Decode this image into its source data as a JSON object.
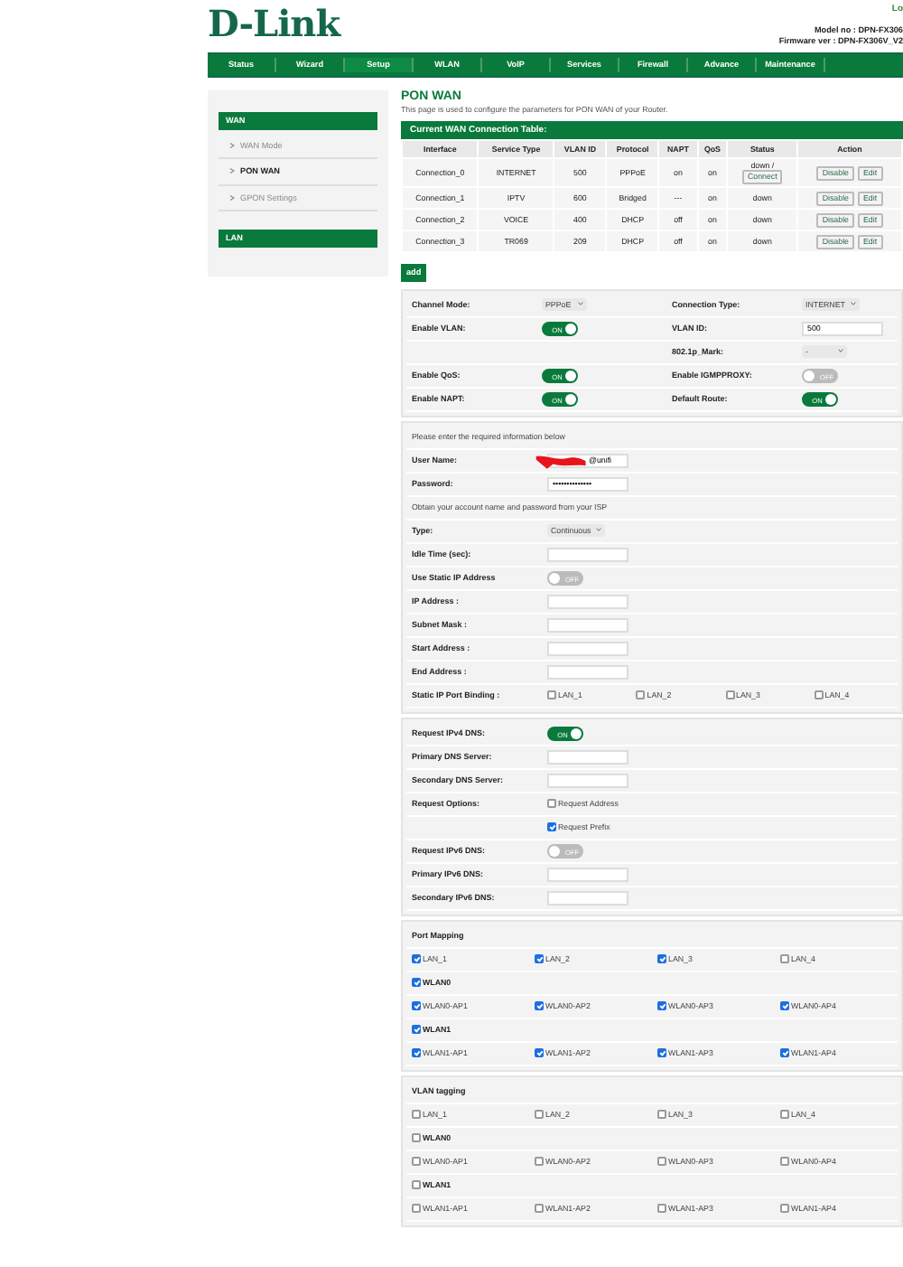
{
  "header": {
    "logo": "D-Link",
    "logout": "Lo",
    "model": "Model no : DPN-FX306",
    "firmware": "Firmware ver : DPN-FX306V_V2"
  },
  "nav": [
    {
      "label": "Status",
      "selected": false
    },
    {
      "label": "Wizard",
      "selected": false
    },
    {
      "label": "Setup",
      "selected": true
    },
    {
      "label": "WLAN",
      "selected": false
    },
    {
      "label": "VoIP",
      "selected": false
    },
    {
      "label": "Services",
      "selected": false
    },
    {
      "label": "Firewall",
      "selected": false
    },
    {
      "label": "Advance",
      "selected": false
    },
    {
      "label": "Maintenance",
      "selected": false
    }
  ],
  "sidebar": [
    {
      "title": "WAN",
      "items": [
        {
          "label": "WAN Mode",
          "selected": false
        },
        {
          "label": "PON WAN",
          "selected": true
        },
        {
          "label": "GPON Settings",
          "selected": false
        }
      ]
    },
    {
      "title": "LAN"
    }
  ],
  "page": {
    "title": "PON WAN",
    "description": "This page is used to configure the parameters for PON WAN of your Router."
  },
  "wan_table": {
    "title": "Current WAN Connection Table:",
    "columns": [
      "Interface",
      "Service Type",
      "VLAN ID",
      "Protocol",
      "NAPT",
      "QoS",
      "Status",
      "Action"
    ],
    "rows": [
      {
        "cells": [
          "Connection_0",
          "INTERNET",
          "500",
          "PPPoE",
          "on",
          "on",
          "down /"
        ],
        "status_button": "Connect",
        "actions": [
          "Disable",
          "Edit"
        ]
      },
      {
        "cells": [
          "Connection_1",
          "IPTV",
          "600",
          "Bridged",
          "---",
          "on",
          "down"
        ],
        "actions": [
          "Disable",
          "Edit"
        ]
      },
      {
        "cells": [
          "Connection_2",
          "VOICE",
          "400",
          "DHCP",
          "off",
          "on",
          "down"
        ],
        "actions": [
          "Disable",
          "Edit"
        ]
      },
      {
        "cells": [
          "Connection_3",
          "TR069",
          "209",
          "DHCP",
          "off",
          "on",
          "down"
        ],
        "actions": [
          "Disable",
          "Edit"
        ]
      }
    ]
  },
  "add_button": "add",
  "settings": [
    [
      {
        "kind": "label",
        "text": "Channel Mode:"
      },
      {
        "kind": "select",
        "value": "PPPoE"
      },
      {
        "kind": "label",
        "text": "Connection Type:"
      },
      {
        "kind": "select",
        "value": "INTERNET"
      }
    ],
    [
      {
        "kind": "label",
        "text": "Enable VLAN:"
      },
      {
        "kind": "toggle",
        "on": true,
        "text": "ON"
      },
      {
        "kind": "label",
        "text": "VLAN ID:"
      },
      {
        "kind": "input",
        "value": "500"
      }
    ],
    [
      {
        "kind": "empty"
      },
      {
        "kind": "empty"
      },
      {
        "kind": "label",
        "text": "802.1p_Mark:"
      },
      {
        "kind": "select",
        "value": "-"
      }
    ],
    [
      {
        "kind": "label",
        "text": "Enable QoS:"
      },
      {
        "kind": "toggle",
        "on": true,
        "text": "ON"
      },
      {
        "kind": "label",
        "text": "Enable IGMPPROXY:"
      },
      {
        "kind": "toggle",
        "on": false,
        "text": "OFF"
      }
    ],
    [
      {
        "kind": "label",
        "text": "Enable NAPT:"
      },
      {
        "kind": "toggle",
        "on": true,
        "text": "ON"
      },
      {
        "kind": "label",
        "text": "Default Route:"
      },
      {
        "kind": "toggle",
        "on": true,
        "text": "ON"
      }
    ]
  ],
  "ppp": [
    [
      {
        "kind": "note",
        "text": "Please enter the required information below"
      }
    ],
    [
      {
        "kind": "label",
        "text": "User Name:"
      },
      {
        "kind": "input",
        "value": "@unifi",
        "redacted": true
      }
    ],
    [
      {
        "kind": "label",
        "text": "Password:"
      },
      {
        "kind": "input",
        "value": "••••••••••••••"
      }
    ],
    [
      {
        "kind": "note",
        "text": "Obtain your account name and password from your ISP"
      }
    ],
    [
      {
        "kind": "label",
        "text": "Type:"
      },
      {
        "kind": "select",
        "value": "Continuous"
      }
    ],
    [
      {
        "kind": "label",
        "text": "Idle Time (sec):"
      },
      {
        "kind": "input"
      }
    ],
    [
      {
        "kind": "label",
        "text": "Use Static IP Address"
      },
      {
        "kind": "toggle",
        "on": false,
        "text": "OFF"
      }
    ],
    [
      {
        "kind": "label",
        "text": "IP Address :"
      },
      {
        "kind": "input"
      }
    ],
    [
      {
        "kind": "label",
        "text": "Subnet Mask :"
      },
      {
        "kind": "input"
      }
    ],
    [
      {
        "kind": "label",
        "text": "Start Address :"
      },
      {
        "kind": "input"
      }
    ],
    [
      {
        "kind": "label",
        "text": "End Address :"
      },
      {
        "kind": "input"
      }
    ],
    [
      {
        "kind": "label",
        "text": "Static IP Port Binding :"
      },
      {
        "kind": "checkbox",
        "label": "LAN_1",
        "checked": false
      },
      {
        "kind": "checkbox",
        "label": "LAN_2",
        "checked": false
      },
      {
        "kind": "checkbox",
        "label": "LAN_3",
        "checked": false
      },
      {
        "kind": "checkbox",
        "label": "LAN_4",
        "checked": false
      }
    ]
  ],
  "dns": [
    [
      {
        "kind": "label",
        "text": "Request IPv4 DNS:"
      },
      {
        "kind": "toggle",
        "on": true,
        "text": "ON"
      }
    ],
    [
      {
        "kind": "label",
        "text": "Primary DNS Server:"
      },
      {
        "kind": "input"
      }
    ],
    [
      {
        "kind": "label",
        "text": "Secondary DNS Server:"
      },
      {
        "kind": "input"
      }
    ],
    [
      {
        "kind": "label",
        "text": "Request Options:"
      },
      {
        "kind": "checkbox",
        "label": "Request Address",
        "checked": false
      }
    ],
    [
      {
        "kind": "empty"
      },
      {
        "kind": "checkbox",
        "label": "Request Prefix",
        "checked": true
      }
    ],
    [
      {
        "kind": "label",
        "text": "Request IPv6 DNS:"
      },
      {
        "kind": "toggle",
        "on": false,
        "text": "OFF"
      }
    ],
    [
      {
        "kind": "label",
        "text": "Primary IPv6 DNS:"
      },
      {
        "kind": "input"
      }
    ],
    [
      {
        "kind": "label",
        "text": "Secondary IPv6 DNS:"
      },
      {
        "kind": "input"
      }
    ]
  ],
  "port_mapping": [
    [
      {
        "kind": "heading",
        "text": "Port Mapping"
      }
    ],
    [
      {
        "kind": "checkbox",
        "label": "LAN_1",
        "checked": true
      },
      {
        "kind": "checkbox",
        "label": "LAN_2",
        "checked": true
      },
      {
        "kind": "checkbox",
        "label": "LAN_3",
        "checked": true
      },
      {
        "kind": "checkbox",
        "label": "LAN_4",
        "checked": false
      }
    ],
    [
      {
        "kind": "group",
        "label": "WLAN0",
        "checked": true
      }
    ],
    [
      {
        "kind": "checkbox",
        "label": "WLAN0-AP1",
        "checked": true
      },
      {
        "kind": "checkbox",
        "label": "WLAN0-AP2",
        "checked": true
      },
      {
        "kind": "checkbox",
        "label": "WLAN0-AP3",
        "checked": true
      },
      {
        "kind": "checkbox",
        "label": "WLAN0-AP4",
        "checked": true
      }
    ],
    [
      {
        "kind": "group",
        "label": "WLAN1",
        "checked": true
      }
    ],
    [
      {
        "kind": "checkbox",
        "label": "WLAN1-AP1",
        "checked": true
      },
      {
        "kind": "checkbox",
        "label": "WLAN1-AP2",
        "checked": true
      },
      {
        "kind": "checkbox",
        "label": "WLAN1-AP3",
        "checked": true
      },
      {
        "kind": "checkbox",
        "label": "WLAN1-AP4",
        "checked": true
      }
    ]
  ],
  "vlan_tagging": [
    [
      {
        "kind": "heading",
        "text": "VLAN tagging"
      }
    ],
    [
      {
        "kind": "checkbox",
        "label": "LAN_1",
        "checked": false
      },
      {
        "kind": "checkbox",
        "label": "LAN_2",
        "checked": false
      },
      {
        "kind": "checkbox",
        "label": "LAN_3",
        "checked": false
      },
      {
        "kind": "checkbox",
        "label": "LAN_4",
        "checked": false
      }
    ],
    [
      {
        "kind": "group",
        "label": "WLAN0",
        "checked": false
      }
    ],
    [
      {
        "kind": "checkbox",
        "label": "WLAN0-AP1",
        "checked": false
      },
      {
        "kind": "checkbox",
        "label": "WLAN0-AP2",
        "checked": false
      },
      {
        "kind": "checkbox",
        "label": "WLAN0-AP3",
        "checked": false
      },
      {
        "kind": "checkbox",
        "label": "WLAN0-AP4",
        "checked": false
      }
    ],
    [
      {
        "kind": "group",
        "label": "WLAN1",
        "checked": false
      }
    ],
    [
      {
        "kind": "checkbox",
        "label": "WLAN1-AP1",
        "checked": false
      },
      {
        "kind": "checkbox",
        "label": "WLAN1-AP2",
        "checked": false
      },
      {
        "kind": "checkbox",
        "label": "WLAN1-AP3",
        "checked": false
      },
      {
        "kind": "checkbox",
        "label": "WLAN1-AP4",
        "checked": false
      }
    ]
  ]
}
